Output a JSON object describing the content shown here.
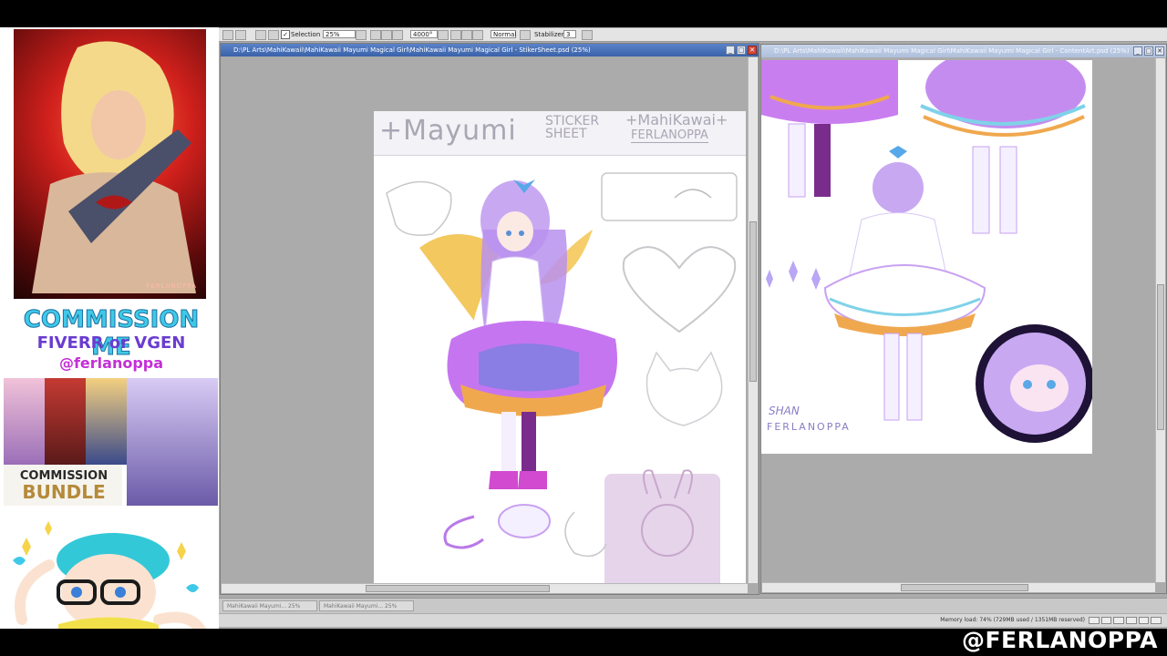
{
  "toolbar": {
    "selection_label": "Selection",
    "selection_checked": "✓",
    "zoom_value": "25%",
    "size_value": "4000°",
    "blend_value": "Normal",
    "stabilizer_label": "Stabilizer",
    "stabilizer_value": "3"
  },
  "window1": {
    "title": "D:\\PL Arts\\MahiKawaii\\MahiKawaii Mayumi Magical Girl\\MahiKawaii Mayumi Magical Girl - StikerSheet.psd (25%)",
    "controls": [
      "_",
      "□",
      "✕"
    ]
  },
  "window2": {
    "title": "D:\\PL Arts\\MahiKawaii\\MahiKawaii Mayumi Magical Girl\\MahiKawaii Mayumi Magical Girl - ContentArt.psd (25%)",
    "controls": [
      "_",
      "□",
      "✕"
    ]
  },
  "sheet": {
    "title_left": "+Mayumi",
    "title_mid_1": "STICKER",
    "title_mid_2": "SHEET",
    "title_right_1": "+MahiKawai+",
    "title_right_2": "FERLANOPPA"
  },
  "art": {
    "signature_top": "SHAN",
    "signature_bottom": "FERLANOPPA"
  },
  "overlay": {
    "portrait_signature": "FERLANOPPA",
    "line1": "COMMISSION ME",
    "line2": "FIVERR or VGEN",
    "line3": "@ferlanoppa",
    "bundle_1": "COMMISSION",
    "bundle_2": "BUNDLE"
  },
  "taskbar": {
    "tab1": "MahiKawaii Mayumi...  25%",
    "tab2": "MahiKawaii Mayumi...  25%"
  },
  "status": {
    "memory": "Memory load: 74% (729MB used / 1351MB reserved)"
  },
  "watermark": "@FERLANOPPA",
  "colors": {
    "accent_purple": "#b35cf2",
    "accent_blue": "#5ab4e6",
    "titlebar_active": "#3a62a8",
    "promo_cyan": "#3fc9e8",
    "promo_purple": "#6a3dcf"
  }
}
